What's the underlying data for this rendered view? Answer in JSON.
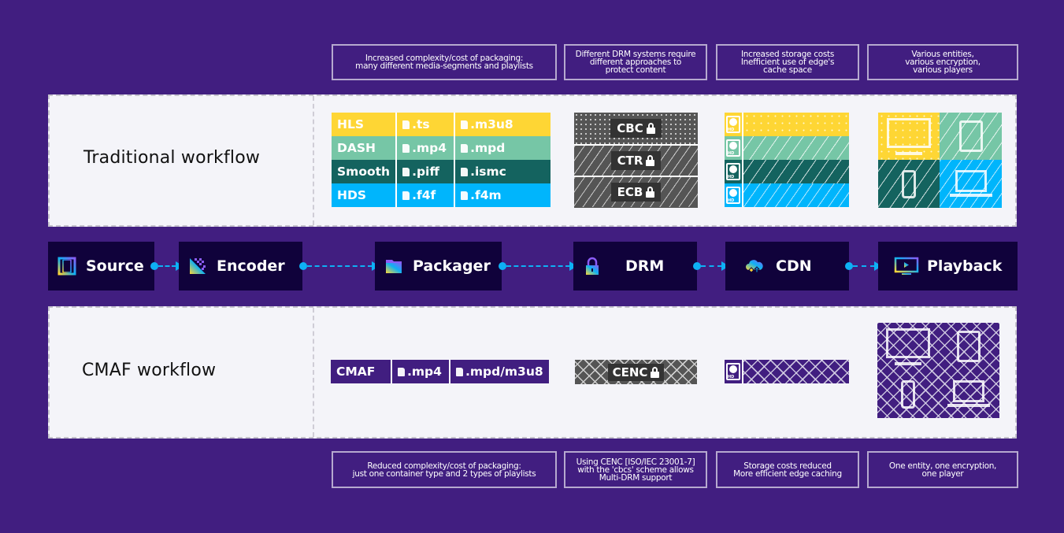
{
  "top_notes": [
    "Increased complexity/cost of packaging:\nmany different media-segments and playlists",
    "Different DRM systems require\ndifferent approaches to\nprotect content",
    "Increased storage costs\nInefficient use of edge's\ncache space",
    "Various entities,\nvarious encryption,\nvarious players"
  ],
  "bottom_notes": [
    "Reduced complexity/cost of packaging:\njust one container type and 2 types of playlists",
    "Using CENC [ISO/IEC 23001-7]\nwith the 'cbcs' scheme allows\nMulti-DRM support",
    "Storage costs reduced\nMore efficient edge caching",
    "One entity, one encryption,\none player"
  ],
  "traditional": {
    "label": "Traditional workflow",
    "formats": [
      {
        "name": "HLS",
        "segment": ".ts",
        "playlist": ".m3u8",
        "color": "#fed634"
      },
      {
        "name": "DASH",
        "segment": ".mp4",
        "playlist": ".mpd",
        "color": "#76c6a6"
      },
      {
        "name": "Smooth",
        "segment": ".piff",
        "playlist": ".ismc",
        "color": "#14635f"
      },
      {
        "name": "HDS",
        "segment": ".f4f",
        "playlist": ".f4m",
        "color": "#00b5fc"
      }
    ],
    "encryption": [
      "CBC",
      "CTR",
      "ECB"
    ]
  },
  "cmaf": {
    "label": "CMAF workflow",
    "format": {
      "name": "CMAF",
      "segment": ".mp4",
      "playlist": ".mpd/m3u8",
      "color": "#411e80"
    },
    "encryption": "CENC"
  },
  "pipeline": [
    {
      "label": "Source",
      "icon": "film-icon"
    },
    {
      "label": "Encoder",
      "icon": "encoder-icon"
    },
    {
      "label": "Packager",
      "icon": "folder-icon"
    },
    {
      "label": "DRM",
      "icon": "lock-icon"
    },
    {
      "label": "CDN",
      "icon": "cloud-icon"
    },
    {
      "label": "Playback",
      "icon": "monitor-play-icon"
    }
  ],
  "colors": {
    "background": "#411e80",
    "stage": "#10023b",
    "arrow": "#0db1f5",
    "panel": "#f4f4f9"
  }
}
